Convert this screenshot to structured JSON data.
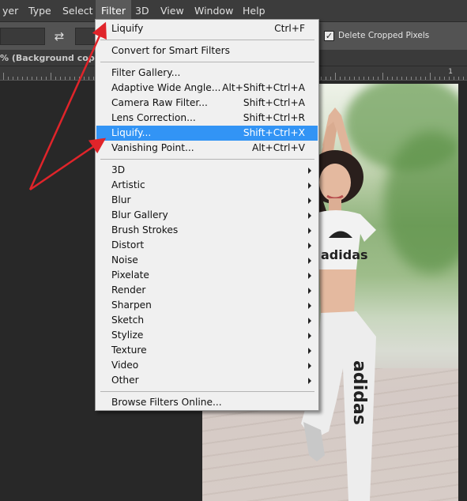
{
  "menubar": {
    "items": [
      {
        "label": "yer",
        "active": false
      },
      {
        "label": "Type",
        "active": false
      },
      {
        "label": "Select",
        "active": false
      },
      {
        "label": "Filter",
        "active": true
      },
      {
        "label": "3D",
        "active": false
      },
      {
        "label": "View",
        "active": false
      },
      {
        "label": "Window",
        "active": false
      },
      {
        "label": "Help",
        "active": false
      }
    ]
  },
  "options_bar": {
    "delete_cropped_label": "Delete Cropped Pixels",
    "delete_cropped_checked": true,
    "swap_icon": "swap-arrows-icon"
  },
  "document": {
    "tab_title": "% (Background copy, RG"
  },
  "ruler": {
    "label": "1"
  },
  "filter_menu": {
    "items": [
      {
        "type": "item",
        "label": "Liquify",
        "shortcut": "Ctrl+F"
      },
      {
        "type": "separator"
      },
      {
        "type": "item",
        "label": "Convert for Smart Filters",
        "shortcut": ""
      },
      {
        "type": "separator"
      },
      {
        "type": "item",
        "label": "Filter Gallery...",
        "shortcut": ""
      },
      {
        "type": "item",
        "label": "Adaptive Wide Angle...",
        "shortcut": "Alt+Shift+Ctrl+A"
      },
      {
        "type": "item",
        "label": "Camera Raw Filter...",
        "shortcut": "Shift+Ctrl+A"
      },
      {
        "type": "item",
        "label": "Lens Correction...",
        "shortcut": "Shift+Ctrl+R"
      },
      {
        "type": "item",
        "label": "Liquify...",
        "shortcut": "Shift+Ctrl+X",
        "highlighted": true
      },
      {
        "type": "item",
        "label": "Vanishing Point...",
        "shortcut": "Alt+Ctrl+V"
      },
      {
        "type": "separator"
      },
      {
        "type": "submenu",
        "label": "3D"
      },
      {
        "type": "submenu",
        "label": "Artistic"
      },
      {
        "type": "submenu",
        "label": "Blur"
      },
      {
        "type": "submenu",
        "label": "Blur Gallery"
      },
      {
        "type": "submenu",
        "label": "Brush Strokes"
      },
      {
        "type": "submenu",
        "label": "Distort"
      },
      {
        "type": "submenu",
        "label": "Noise"
      },
      {
        "type": "submenu",
        "label": "Pixelate"
      },
      {
        "type": "submenu",
        "label": "Render"
      },
      {
        "type": "submenu",
        "label": "Sharpen"
      },
      {
        "type": "submenu",
        "label": "Sketch"
      },
      {
        "type": "submenu",
        "label": "Stylize"
      },
      {
        "type": "submenu",
        "label": "Texture"
      },
      {
        "type": "submenu",
        "label": "Video"
      },
      {
        "type": "submenu",
        "label": "Other"
      },
      {
        "type": "separator"
      },
      {
        "type": "item",
        "label": "Browse Filters Online...",
        "shortcut": ""
      }
    ]
  },
  "annotation": {
    "arrow_color": "#e0242a"
  },
  "colors": {
    "menubar_bg": "#3c3c3c",
    "options_bg": "#535353",
    "menu_bg": "#f0f0f0",
    "highlight": "#3294f5",
    "workspace_bg": "#282828"
  }
}
